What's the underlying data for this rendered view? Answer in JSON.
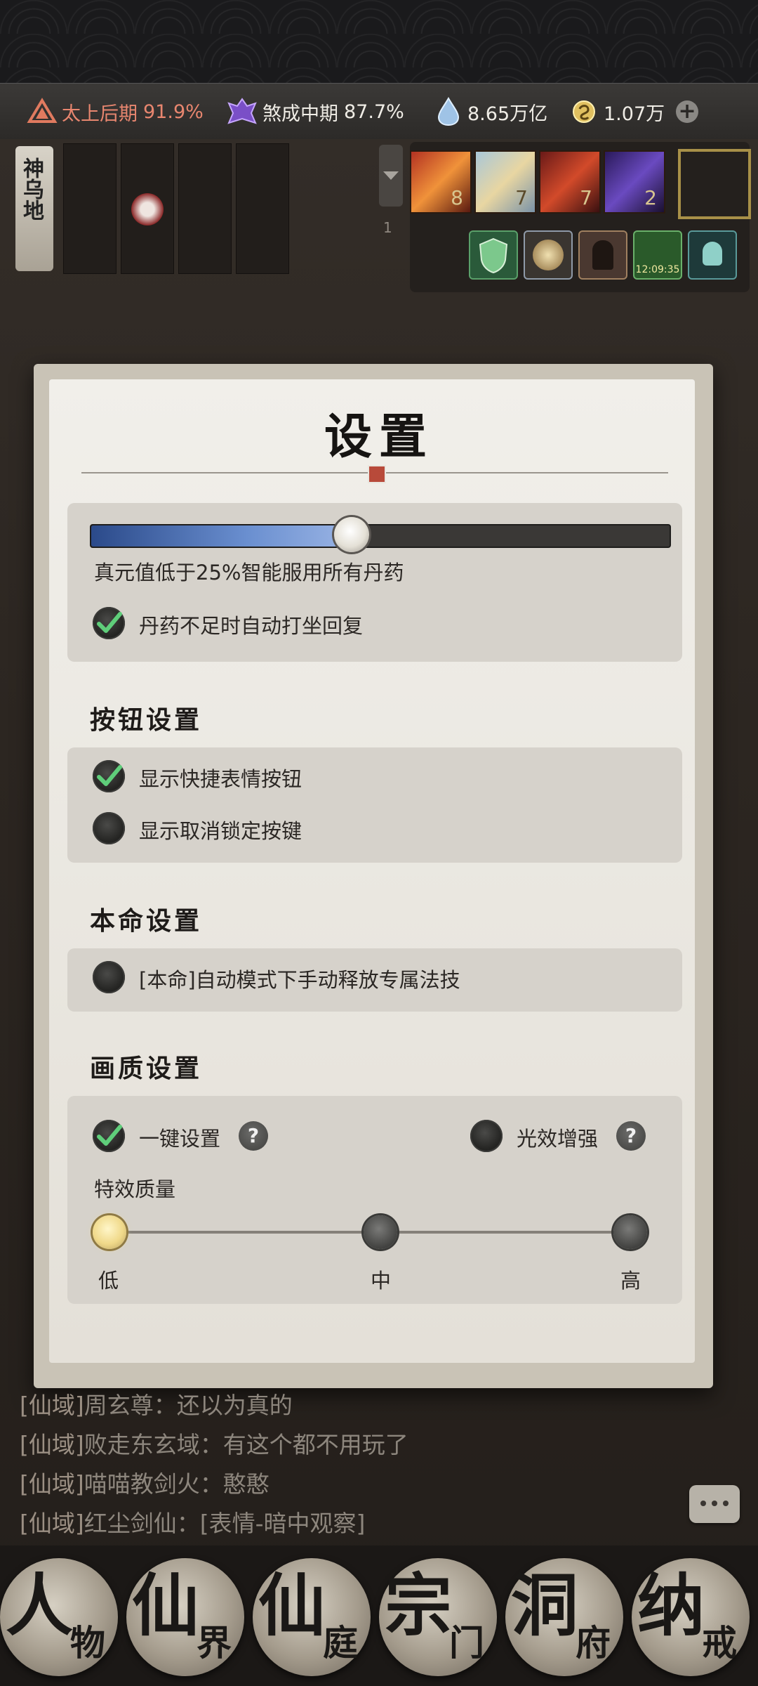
{
  "resources": {
    "cultivation": {
      "icon": "realm-icon",
      "name": "太上后期",
      "percent": "91.9%",
      "color": "#e8866f"
    },
    "soul": {
      "icon": "demon-icon",
      "name": "煞成中期",
      "percent": "87.7%"
    },
    "spirit_stone": {
      "icon": "water-drop-icon",
      "value": "8.65万亿"
    },
    "gold": {
      "icon": "coin-icon",
      "value": "1.07万"
    },
    "add_icon": "plus-icon"
  },
  "top_left": {
    "location_label": "神乌地",
    "slot_count": "1"
  },
  "skills": {
    "counts": [
      "8",
      "7",
      "7",
      "2"
    ]
  },
  "buffs": {
    "timer": "12:09:35"
  },
  "dialog": {
    "title": "设置",
    "elixir_threshold_percent": 45,
    "elixir_text": "真元值低于25%智能服用所有丹药",
    "auto_meditate_label": "丹药不足时自动打坐回复",
    "auto_meditate_checked": true,
    "button_section": "按钮设置",
    "show_emote_label": "显示快捷表情按钮",
    "show_emote_checked": true,
    "show_unlock_label": "显示取消锁定按键",
    "show_unlock_checked": false,
    "natal_section": "本命设置",
    "natal_manual_label": "[本命]自动模式下手动释放专属法技",
    "natal_manual_checked": false,
    "graphics_section": "画质设置",
    "one_key_label": "一键设置",
    "one_key_checked": true,
    "light_boost_label": "光效增强",
    "light_boost_checked": false,
    "effect_quality_label": "特效质量",
    "quality_options": [
      "低",
      "中",
      "高"
    ],
    "quality_selected": "低"
  },
  "chat": [
    {
      "channel": "[仙域]",
      "name": "周玄尊：",
      "msg": "还以为真的"
    },
    {
      "channel": "[仙域]",
      "name": "败走东玄域：",
      "msg": "有这个都不用玩了"
    },
    {
      "channel": "[仙域]",
      "name": "喵喵教剑火：",
      "msg": "憨憨"
    },
    {
      "channel": "[仙域]",
      "name": "红尘剑仙：",
      "msg": "[表情-暗中观察]"
    }
  ],
  "nav": [
    {
      "big": "人",
      "small": "物"
    },
    {
      "big": "仙",
      "small": "界"
    },
    {
      "big": "仙",
      "small": "庭"
    },
    {
      "big": "宗",
      "small": "门"
    },
    {
      "big": "洞",
      "small": "府"
    },
    {
      "big": "纳",
      "small": "戒"
    }
  ]
}
